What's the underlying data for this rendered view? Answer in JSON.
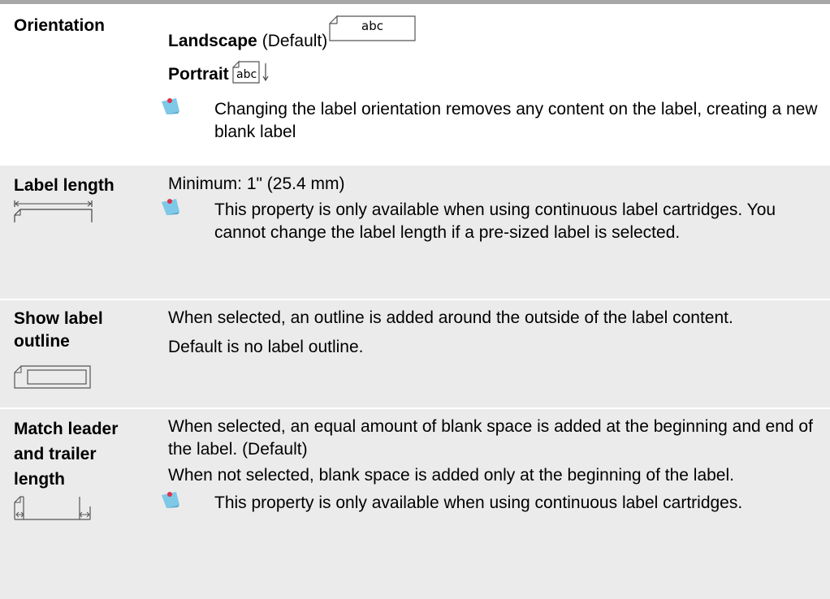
{
  "rows": [
    {
      "term": "Orientation",
      "landscape": {
        "name": "Landscape",
        "suffix": "(Default)",
        "icon_text": "abc"
      },
      "portrait": {
        "name": "Portrait",
        "icon_text": "abc"
      },
      "note": "Changing the label orientation removes any content on the label, creating a new blank label"
    },
    {
      "term": "Label length",
      "lines": [
        "Minimum: 1\" (25.4 mm)"
      ],
      "note": "This property is only available when using continuous label cartridges. You cannot change the label length if a pre-sized label is selected."
    },
    {
      "term": "Show label outline",
      "lines": [
        "When selected, an outline is added around the outside of the label content.",
        "Default is no label outline."
      ]
    },
    {
      "term": "Match leader and trailer length",
      "lines": [
        "When selected, an equal amount of blank space is added at the beginning and end of the label. (Default)",
        "When not selected, blank space is added only at the beginning of the label."
      ],
      "note": "This property is only available when using continuous label cartridges."
    }
  ],
  "colors": {
    "shade": "#ebebeb",
    "rule": "#a8a8a8",
    "note_blue": "#7ec8e8",
    "note_red": "#e0304a"
  }
}
